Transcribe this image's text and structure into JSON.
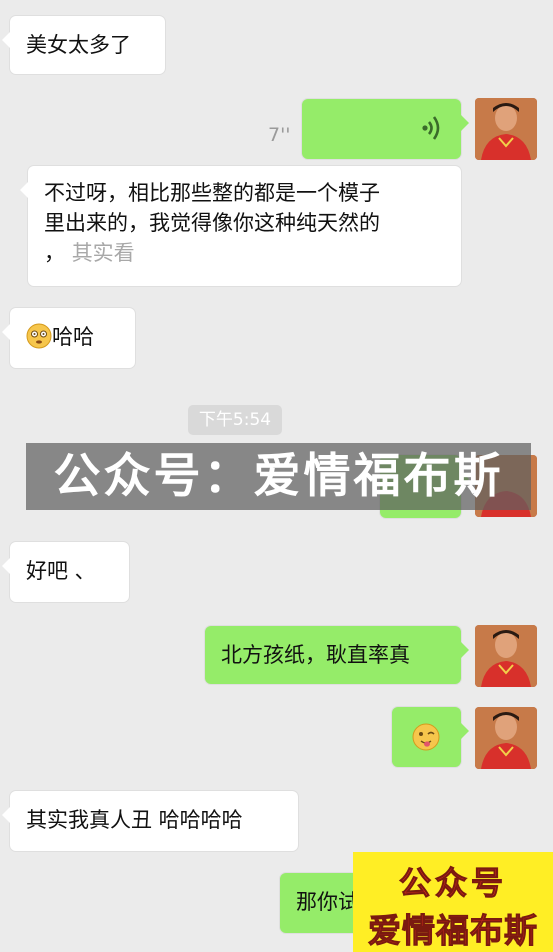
{
  "messages": {
    "m1": "美女太多了",
    "m2_duration": "7''",
    "m3_line1": "不过呀，相比那些整的都是一个模子",
    "m3_line2": "里出来的，我觉得像你这种纯天然的",
    "m3_line3_a": "，",
    "m3_line3_b": "其实看",
    "m4_text": "哈哈",
    "timestamp": "下午5:54",
    "m6": "好吧  、",
    "m7": "北方孩纸，耿直率真",
    "m9": "其实我真人丑 哈哈哈哈",
    "m10": "那你试"
  },
  "icons": {
    "m4_emoji": "dizzy-face-emoji",
    "m8_emoji": "winking-tongue-emoji",
    "voice": "voice-wave-icon"
  },
  "watermark": {
    "banner": "公众号：爱情福布斯",
    "promo_line1": "公众号",
    "promo_line2": "爱情福布斯"
  },
  "colors": {
    "background": "#ebebeb",
    "bubble_left": "#ffffff",
    "bubble_right": "#95ec69",
    "promo_bg": "#ffee25",
    "promo_text": "#e02c1d"
  }
}
